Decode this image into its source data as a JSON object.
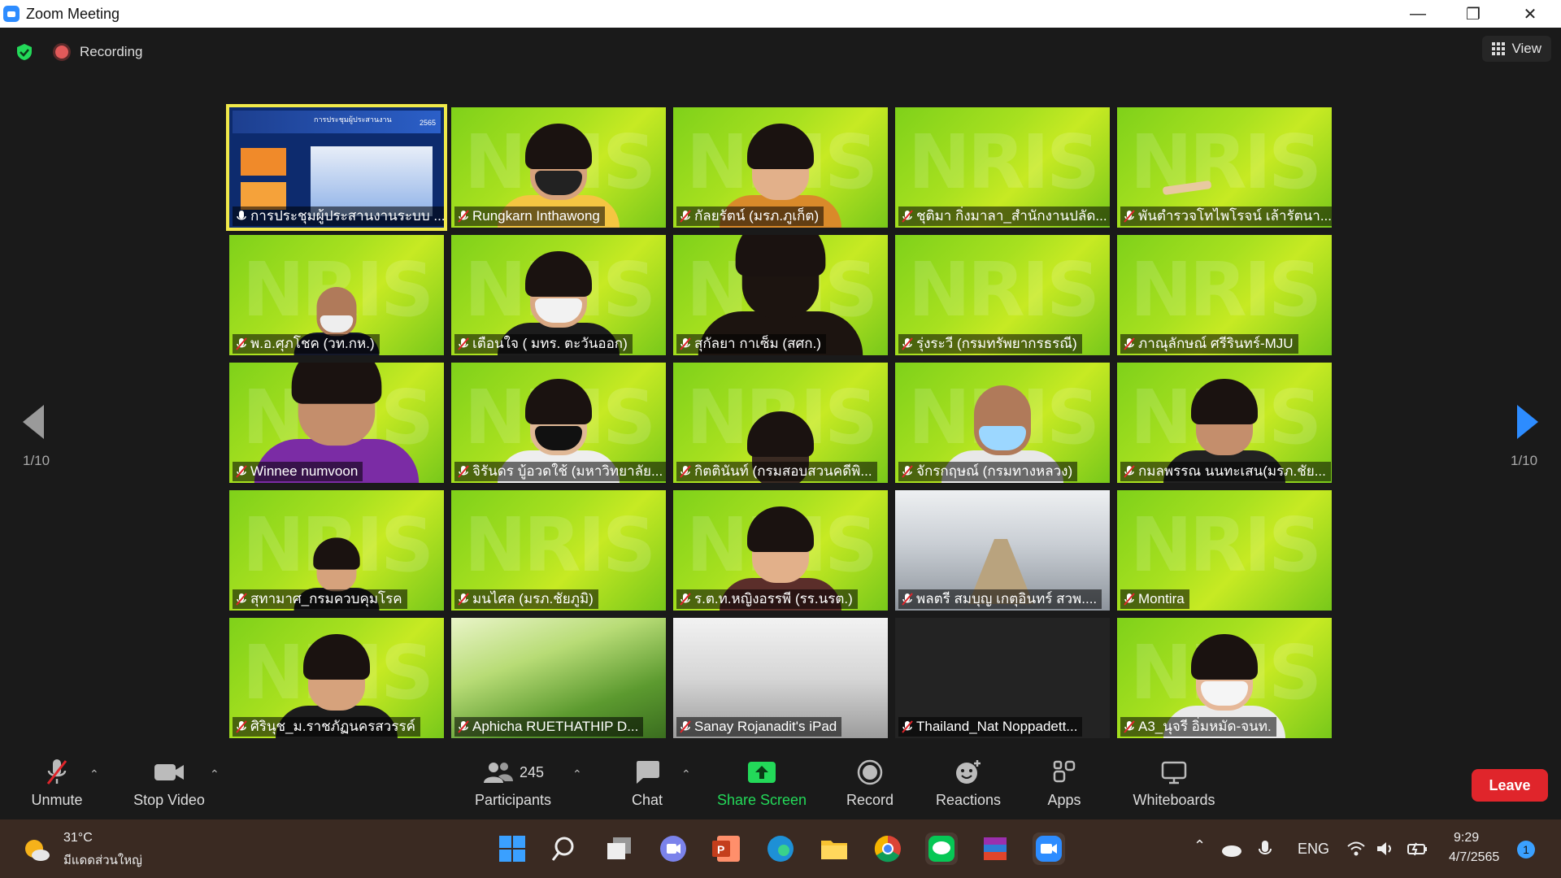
{
  "window": {
    "title": "Zoom Meeting"
  },
  "topbar": {
    "recording_label": "Recording",
    "view_label": "View"
  },
  "pager": {
    "left": "1/10",
    "right": "1/10"
  },
  "tiles": [
    {
      "name": "การประชุมผู้ประสานงานระบบ ...",
      "mic": "on"
    },
    {
      "name": "Rungkarn Inthawong"
    },
    {
      "name": "กัลยรัตน์ (มรภ.ภูเก็ต)"
    },
    {
      "name": "ชุติมา กิ่งมาลา_สำนักงานปลัด..."
    },
    {
      "name": "พันตำรวจโทไพโรจน์ เล้ารัตนา..."
    },
    {
      "name": "พ.อ.ศุภโชค (วท.กห.)"
    },
    {
      "name": "เตือนใจ ( มทร. ตะวันออก)"
    },
    {
      "name": "สุกัลยา กาเซ็ม (สศก.)"
    },
    {
      "name": "รุ่งระวี (กรมทรัพยากรธรณี)"
    },
    {
      "name": "ภาณุลักษณ์ ศรีรินทร์-MJU"
    },
    {
      "name": "Winnee numvoon"
    },
    {
      "name": "จิรันดร บู้อวดใช้ (มหาวิทยาลัย..."
    },
    {
      "name": "กิตตินันท์ (กรมสอบสวนคดีพิ..."
    },
    {
      "name": "จักรกฤษณ์ (กรมทางหลวง)"
    },
    {
      "name": "กมลพรรณ นนทะเสน(มรภ.ชัย..."
    },
    {
      "name": "สุทามาศ_กรมควบคุมโรค"
    },
    {
      "name": "มนไศล (มรภ.ชัยภูมิ)"
    },
    {
      "name": "ร.ต.ท.หญิงอรรพี (รร.นรต.)"
    },
    {
      "name": "พลตรี สมบุญ เกตุอินทร์ สวพ...."
    },
    {
      "name": "Montira"
    },
    {
      "name": "ศิรินุช_ม.ราชภัฏนครสวรรค์"
    },
    {
      "name": "Aphicha RUETHATHIP D..."
    },
    {
      "name": "Sanay Rojanadit's iPad"
    },
    {
      "name": "Thailand_Nat Noppadett..."
    },
    {
      "name": "A3_นุจรี อิ่มหมัด-จนท."
    }
  ],
  "watermark": "NRIS",
  "presentation": {
    "header": "การประชุมผู้ประสานงาน",
    "year": "2565"
  },
  "toolbar": {
    "unmute": "Unmute",
    "stop_video": "Stop Video",
    "participants": "Participants",
    "participants_count": "245",
    "chat": "Chat",
    "share_screen": "Share Screen",
    "record": "Record",
    "reactions": "Reactions",
    "apps": "Apps",
    "whiteboards": "Whiteboards",
    "leave": "Leave"
  },
  "taskbar": {
    "weather_temp": "31°C",
    "weather_desc": "มีแดดส่วนใหญ่",
    "language": "ENG",
    "time": "9:29",
    "date": "4/7/2565",
    "notification_count": "1"
  }
}
